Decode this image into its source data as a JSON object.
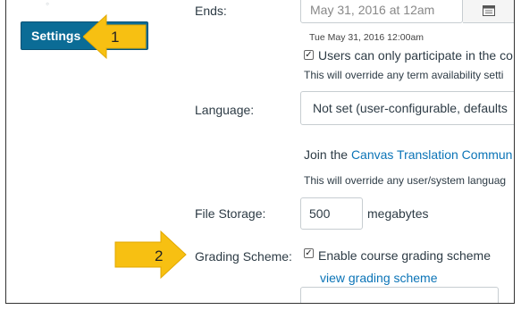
{
  "sidebar": {
    "settings_label": "Settings"
  },
  "markers": {
    "one": "1",
    "two": "2"
  },
  "ends": {
    "label": "Ends:",
    "value": "May 31, 2016 at 12am",
    "date_text": "Tue May 31, 2016 12:00am",
    "checkbox_label": "Users can only participate in the co",
    "note": "This will override any term availability setti"
  },
  "language": {
    "label": "Language:",
    "selected": "Not set (user-configurable, defaults",
    "join_prefix": "Join the ",
    "join_link": "Canvas Translation Commun",
    "note": "This will override any user/system languag"
  },
  "file_storage": {
    "label": "File Storage:",
    "value": "500",
    "unit": "megabytes"
  },
  "grading": {
    "label": "Grading Scheme:",
    "checkbox_label": "Enable course grading scheme",
    "link": "view grading scheme"
  },
  "colors": {
    "accent": "#0b6c96",
    "arrow": "#f7c012",
    "link": "#0b74b7"
  },
  "icons": {
    "calendar": "calendar-icon",
    "check": "checkmark-icon",
    "arrow": "arrow-left-icon"
  }
}
